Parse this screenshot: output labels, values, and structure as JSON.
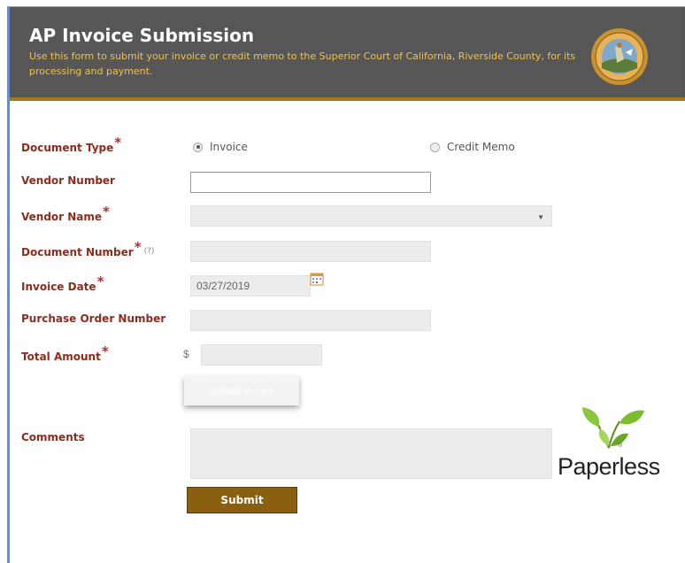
{
  "header": {
    "title": "AP Invoice Submission",
    "subtitle": "Use this form to submit your invoice or credit memo to the Superior Court of California, Riverside County, for its processing and payment."
  },
  "form": {
    "document_type": {
      "label": "Document Type",
      "options": [
        {
          "label": "Invoice",
          "selected": true
        },
        {
          "label": "Credit Memo",
          "selected": false
        }
      ]
    },
    "vendor_number": {
      "label": "Vendor Number",
      "value": ""
    },
    "vendor_name": {
      "label": "Vendor Name",
      "value": ""
    },
    "document_number": {
      "label": "Document Number",
      "help": "(?)",
      "value": ""
    },
    "invoice_date": {
      "label": "Invoice Date",
      "value": "03/27/2019"
    },
    "purchase_order_number": {
      "label": "Purchase Order Number",
      "value": ""
    },
    "total_amount": {
      "label": "Total Amount",
      "currency": "$",
      "value": ""
    },
    "upload_label": "Upload Invoice",
    "comments": {
      "label": "Comments",
      "value": ""
    },
    "submit_label": "Submit",
    "required_mark": "*"
  },
  "logo": {
    "text": "Paperless",
    "mark": "®"
  },
  "colors": {
    "label": "#8b2d1e",
    "required": "#c0282c",
    "header_bg": "#555555",
    "header_rule": "#a8781e",
    "subtitle": "#f0c24a",
    "submit_bg": "#8a5f0f"
  }
}
